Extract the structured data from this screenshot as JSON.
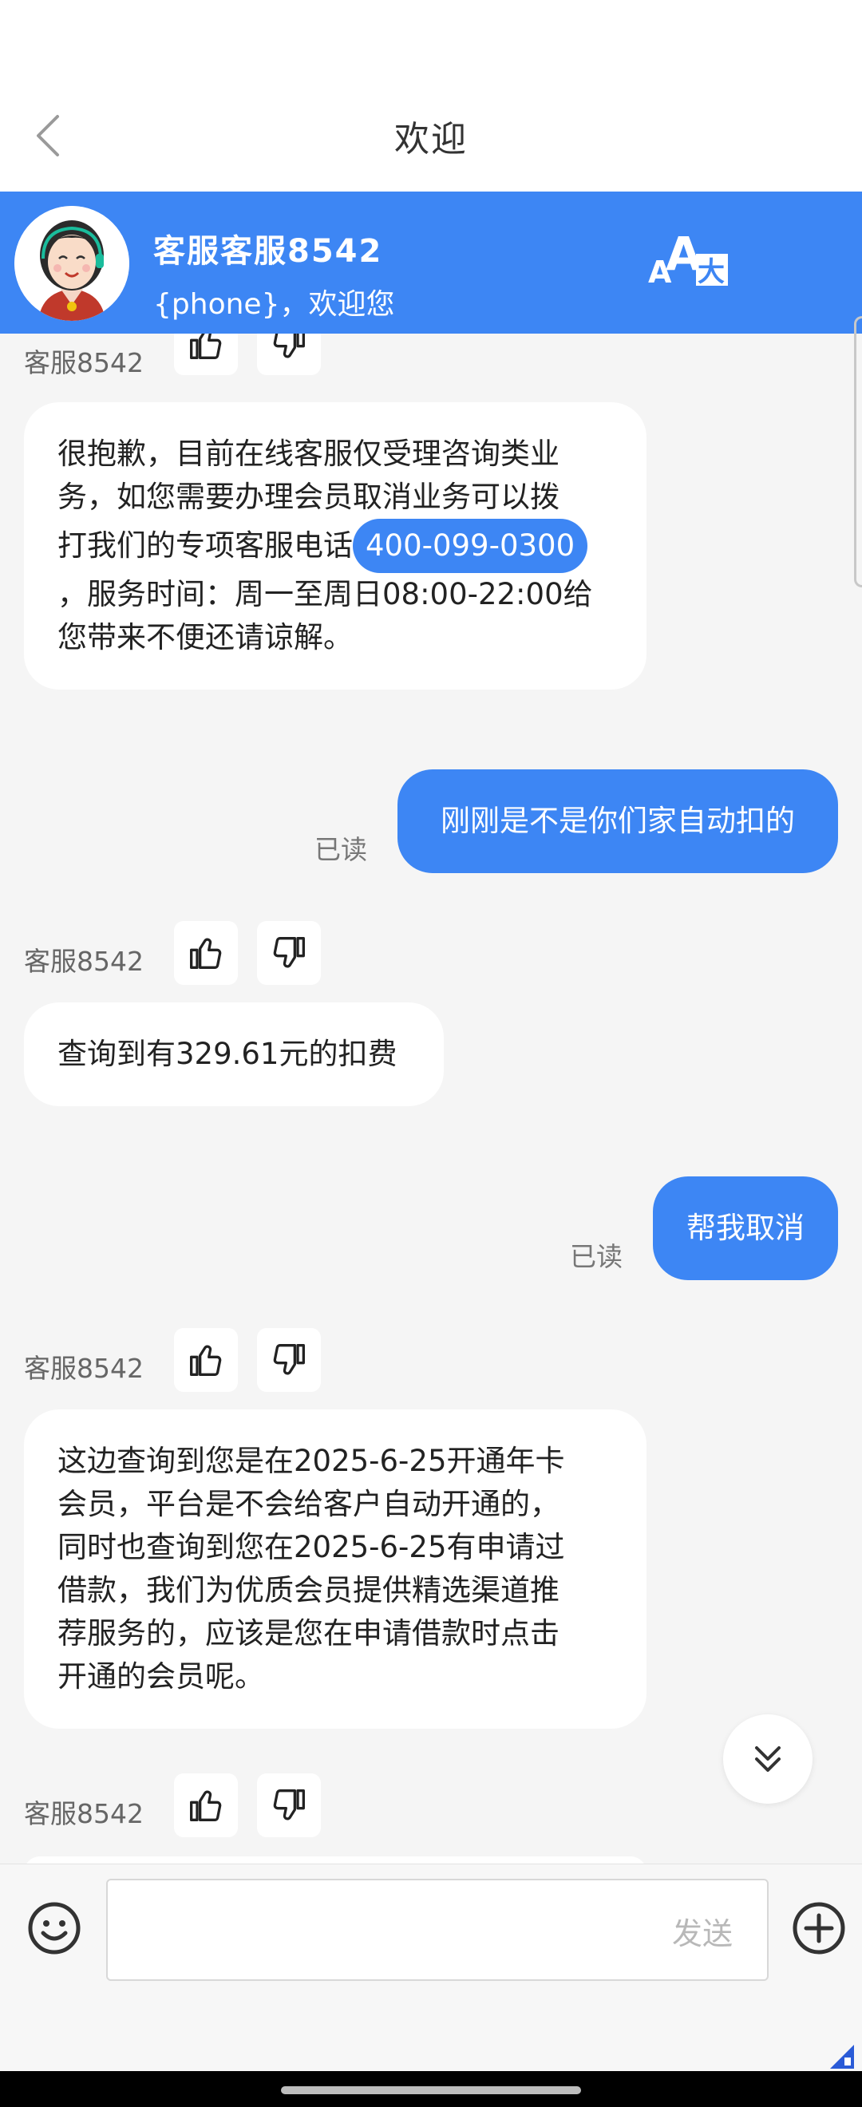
{
  "nav": {
    "title": "欢迎"
  },
  "agent": {
    "name": "客服客服8542",
    "subtitle": "{phone}，欢迎您",
    "font_toggle": "A大"
  },
  "messages": [
    {
      "type": "agent-label",
      "text": "客服8542"
    },
    {
      "type": "in",
      "lines": [
        "很抱歉，目前在线客服仅受理咨询类业",
        "务，如您需要办理会员取消业务可以拨",
        "打我们的专项客服电话"
      ],
      "phone": "400-099-0300",
      "after": [
        "，服务时间：周一至周日08:00-22:00给",
        "您带来不便还请谅解。"
      ]
    },
    {
      "type": "out",
      "text": "刚刚是不是你们家自动扣的",
      "read": "已读"
    },
    {
      "type": "agent-label",
      "text": "客服8542"
    },
    {
      "type": "in",
      "text": "查询到有329.61元的扣费"
    },
    {
      "type": "out",
      "text": "帮我取消",
      "read": "已读"
    },
    {
      "type": "agent-label",
      "text": "客服8542"
    },
    {
      "type": "in",
      "lines": [
        "这边查询到您是在2025-6-25开通年卡",
        "会员，平台是不会给客户自动开通的，",
        "同时也查询到您在2025-6-25有申请过",
        "借款，我们为优质会员提供精选渠道推",
        "荐服务的，应该是您在申请借款时点击",
        "开通的会员呢。"
      ]
    },
    {
      "type": "agent-label",
      "text": "客服8542"
    }
  ],
  "input": {
    "send_label": "发送",
    "placeholder": ""
  },
  "colors": {
    "accent": "#3d86f4",
    "background": "#f5f5f5"
  }
}
